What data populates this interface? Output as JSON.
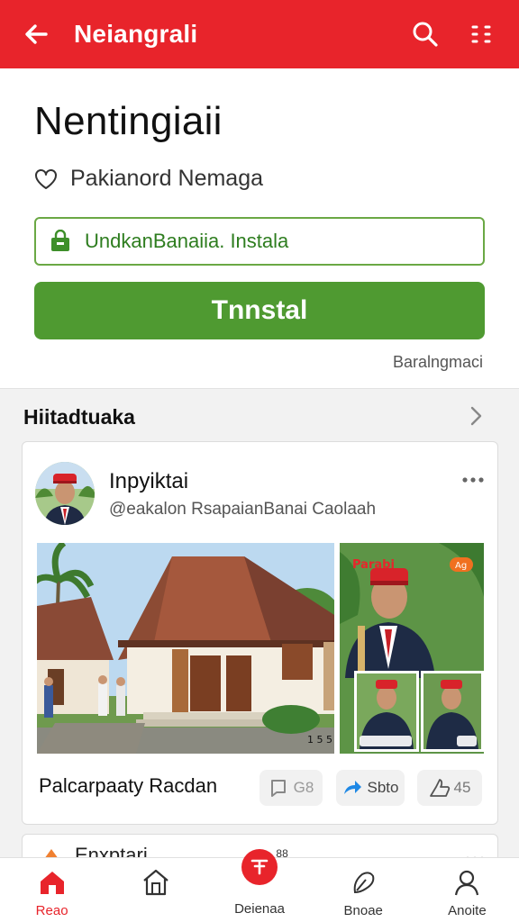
{
  "appbar": {
    "title": "Neiangrali",
    "back_icon": "arrow-left-icon",
    "search_icon": "search-icon",
    "menu_icon": "menu-icon",
    "color": "#e8242b"
  },
  "app": {
    "name": "Nentingiaii",
    "developer": "Pakianord Nemaga",
    "notice": "UndkanBanaiia. Instala",
    "install_label": "Tnnstal",
    "meta_link": "Baralngmaci",
    "accent": "#4f9a31"
  },
  "section": {
    "title": "Hiitadtuaka"
  },
  "post": {
    "author": "Inpyiktai",
    "handle": "@eakalon RsapaianBanai Caolaah",
    "photo_side_label": "Parabi",
    "photo_side_badge": "Ag",
    "photo_main_badge": "1 5 5",
    "caption": "Palcarpaaty Racdan",
    "comment_count": "G8",
    "share_label": "Sbto",
    "like_count": "45"
  },
  "next_post": {
    "title": "Enxptari",
    "badge": "88"
  },
  "nav": [
    {
      "label": "Reao",
      "icon": "home-filled-icon"
    },
    {
      "label": "",
      "icon": "house-outline-icon"
    },
    {
      "label": "Deienaa",
      "icon": "create-icon"
    },
    {
      "label": "Bnoae",
      "icon": "explore-icon"
    },
    {
      "label": "Anoite",
      "icon": "profile-icon"
    }
  ]
}
